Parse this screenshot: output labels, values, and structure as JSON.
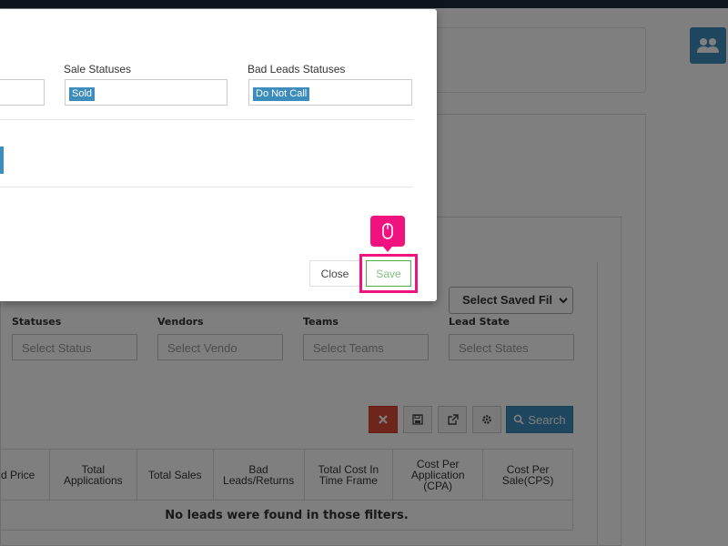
{
  "colors": {
    "accent": "#3c8dbc",
    "danger": "#dd4b39",
    "success": "#4cae4c",
    "click_marker": "#f0127f"
  },
  "header": {
    "users_icon": "users-icon"
  },
  "filters": {
    "saved_filter_label": "Select Saved Fil",
    "statuses": {
      "label": "Statuses",
      "placeholder": "Select Status"
    },
    "vendors": {
      "label": "Vendors",
      "placeholder": "Select Vendo"
    },
    "teams": {
      "label": "Teams",
      "placeholder": "Select Teams"
    },
    "lead_state": {
      "label": "Lead State",
      "placeholder": "Select States"
    }
  },
  "toolbar": {
    "delete_icon": "close-icon",
    "save_icon": "floppy-icon",
    "export_icon": "external-link-icon",
    "settings_icon": "gear-icon",
    "search_label": "Search"
  },
  "table": {
    "headers": [
      "d Price",
      "Total Applications",
      "Total Sales",
      "Bad Leads/Returns",
      "Total Cost In Time Frame",
      "Cost Per Application (CPA)",
      "Cost Per Sale(CPS)"
    ],
    "empty_message": "No leads were found in those filters."
  },
  "modal": {
    "sale_statuses": {
      "label": "Sale Statuses",
      "token": "Sold"
    },
    "bad_leads_statuses": {
      "label": "Bad Leads Statuses",
      "token": "Do Not Call"
    },
    "close_label": "Close",
    "save_label": "Save"
  },
  "click_marker": {
    "icon": "mouse-icon"
  }
}
